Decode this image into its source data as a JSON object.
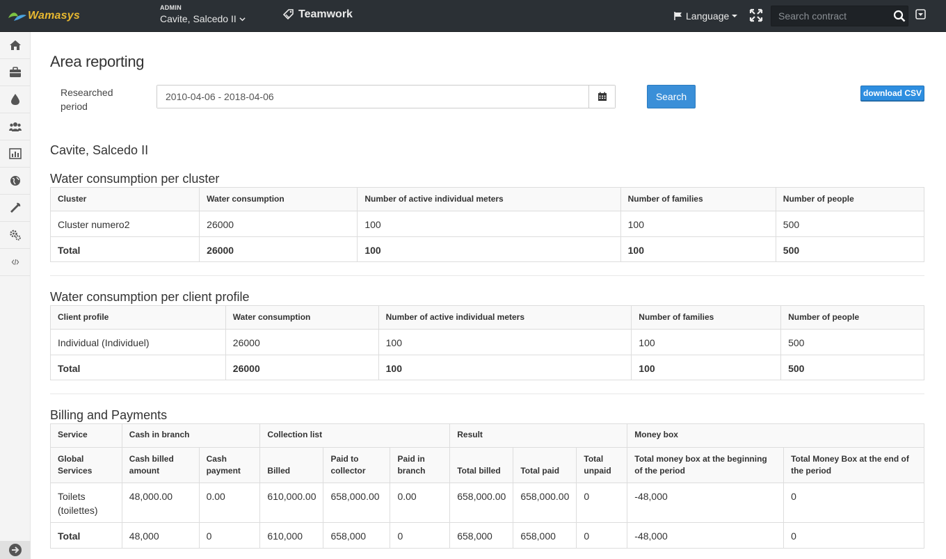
{
  "topbar": {
    "logo_text": "Wamasys",
    "role": "ADMIN",
    "location": "Cavite, Salcedo II",
    "teamwork": "Teamwork",
    "language": "Language",
    "search_placeholder": "Search contract"
  },
  "sidebar": {
    "items": [
      "home-icon",
      "briefcase-icon",
      "drop-icon",
      "users-icon",
      "bar-chart-icon",
      "globe-icon",
      "wrench-icon",
      "gears-icon",
      "code-icon"
    ]
  },
  "page": {
    "title": "Area reporting",
    "period_label": "Researched period",
    "period_value": "2010-04-06 - 2018-04-06",
    "search_button": "Search",
    "csv_button": "download CSV",
    "area_name": "Cavite, Salcedo II"
  },
  "cluster_table": {
    "title": "Water consumption per cluster",
    "headers": [
      "Cluster",
      "Water consumption",
      "Number of active individual meters",
      "Number of families",
      "Number of people"
    ],
    "rows": [
      [
        "Cluster numero2",
        "26000",
        "100",
        "100",
        "500"
      ]
    ],
    "total": [
      "Total",
      "26000",
      "100",
      "100",
      "500"
    ]
  },
  "profile_table": {
    "title": "Water consumption per client profile",
    "headers": [
      "Client profile",
      "Water consumption",
      "Number of active individual meters",
      "Number of families",
      "Number of people"
    ],
    "rows": [
      [
        "Individual (Individuel)",
        "26000",
        "100",
        "100",
        "500"
      ]
    ],
    "total": [
      "Total",
      "26000",
      "100",
      "100",
      "500"
    ]
  },
  "billing_table": {
    "title": "Billing and Payments",
    "groups": [
      "Service",
      "Cash in branch",
      "Collection list",
      "Result",
      "Money box"
    ],
    "headers": [
      "Global Services",
      "Cash billed amount",
      "Cash payment",
      "Billed",
      "Paid to collector",
      "Paid in branch",
      "Total billed",
      "Total paid",
      "Total unpaid",
      "Total money box at the beginning of the period",
      "Total Money Box at the end of the period"
    ],
    "rows": [
      [
        "Toilets (toilettes)",
        "48,000.00",
        "0.00",
        "610,000.00",
        "658,000.00",
        "0.00",
        "658,000.00",
        "658,000.00",
        "0",
        "-48,000",
        "0"
      ]
    ],
    "total": [
      "Total",
      "48,000",
      "0",
      "610,000",
      "658,000",
      "0",
      "658,000",
      "658,000",
      "0",
      "-48,000",
      "0"
    ]
  },
  "colors": {
    "topbar": "#2b3035",
    "logo": "#e8b830",
    "primary_button": "#3a8fd8"
  }
}
